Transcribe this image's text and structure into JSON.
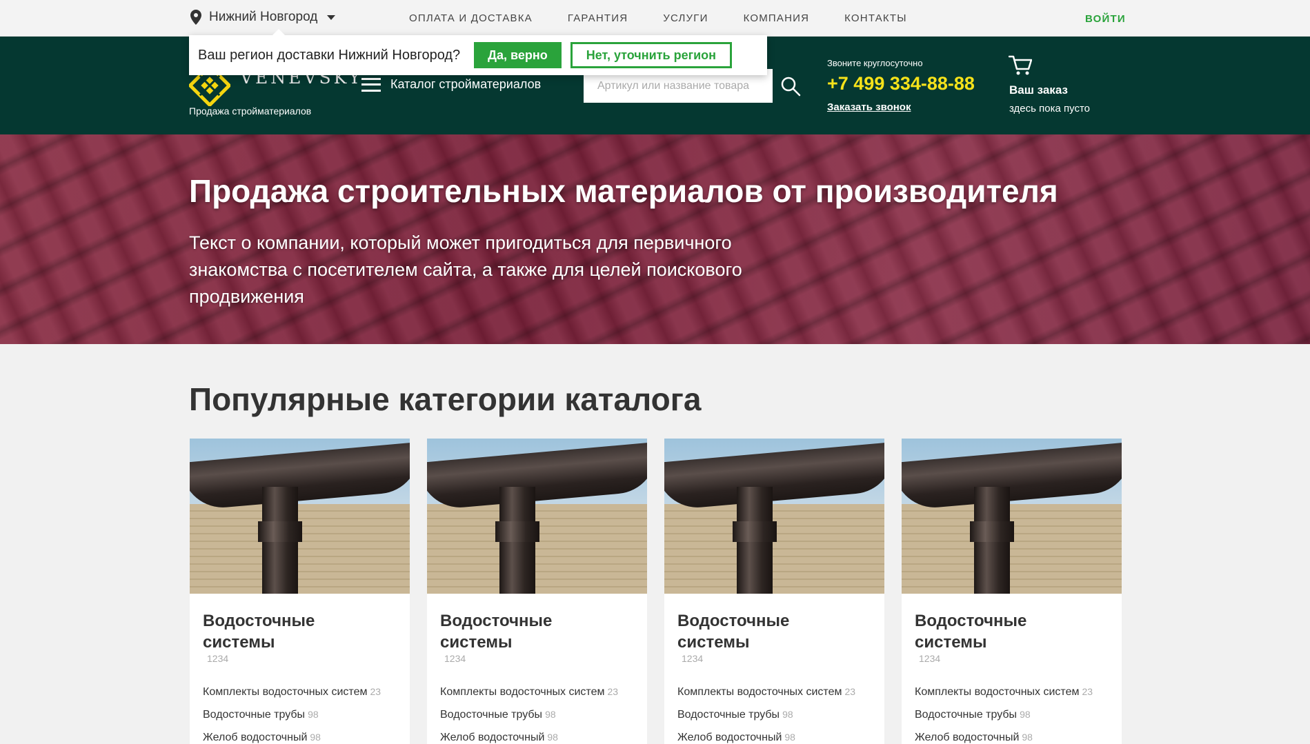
{
  "topbar": {
    "region": "Нижний Новгород",
    "nav": [
      "Оплата и доставка",
      "Гарантия",
      "Услуги",
      "Компания",
      "Контакты"
    ],
    "login": "ВОЙТИ"
  },
  "region_popup": {
    "question": "Ваш регион доставки Нижний Новгород?",
    "yes": "Да, верно",
    "no": "Нет, уточнить регион"
  },
  "header": {
    "logo_text": "VENEVSKY",
    "logo_sub": "Продажа стройматериалов",
    "catalog_label": "Каталог стройматериалов",
    "search_placeholder": "Артикул или название товара",
    "call_label": "Звоните круглосуточно",
    "phone": "+7 499 334-88-88",
    "callback": "Заказать звонок",
    "cart_title": "Ваш заказ",
    "cart_sub": "здесь пока пусто"
  },
  "hero": {
    "title": "Продажа строительных материалов от производителя",
    "text": "Текст о компании, который может пригодиться для первичного знакомства с посетителем сайта, а также для целей поискового продвижения"
  },
  "categories": {
    "title": "Популярные категории каталога",
    "cards": [
      {
        "title": "Водосточные системы",
        "count": "1234",
        "links": [
          {
            "label": "Комплекты водосточных систем",
            "n": "23"
          },
          {
            "label": "Водосточные трубы",
            "n": "98"
          },
          {
            "label": "Желоб водосточный",
            "n": "98"
          }
        ]
      },
      {
        "title": "Водосточные системы",
        "count": "1234",
        "links": [
          {
            "label": "Комплекты водосточных систем",
            "n": "23"
          },
          {
            "label": "Водосточные трубы",
            "n": "98"
          },
          {
            "label": "Желоб водосточный",
            "n": "98"
          }
        ]
      },
      {
        "title": "Водосточные системы",
        "count": "1234",
        "links": [
          {
            "label": "Комплекты водосточных систем",
            "n": "23"
          },
          {
            "label": "Водосточные трубы",
            "n": "98"
          },
          {
            "label": "Желоб водосточный",
            "n": "98"
          }
        ]
      },
      {
        "title": "Водосточные системы",
        "count": "1234",
        "links": [
          {
            "label": "Комплекты водосточных систем",
            "n": "23"
          },
          {
            "label": "Водосточные трубы",
            "n": "98"
          },
          {
            "label": "Желоб водосточный",
            "n": "98"
          }
        ]
      }
    ]
  },
  "colors": {
    "header_bg": "#053831",
    "accent_green": "#2aa33b",
    "phone_yellow": "#f6e21a",
    "logo_yellow": "#f5d60f"
  },
  "icons": [
    "location-pin-icon",
    "chevron-down-icon",
    "menu-icon",
    "search-icon",
    "cart-icon",
    "logo-icon"
  ]
}
